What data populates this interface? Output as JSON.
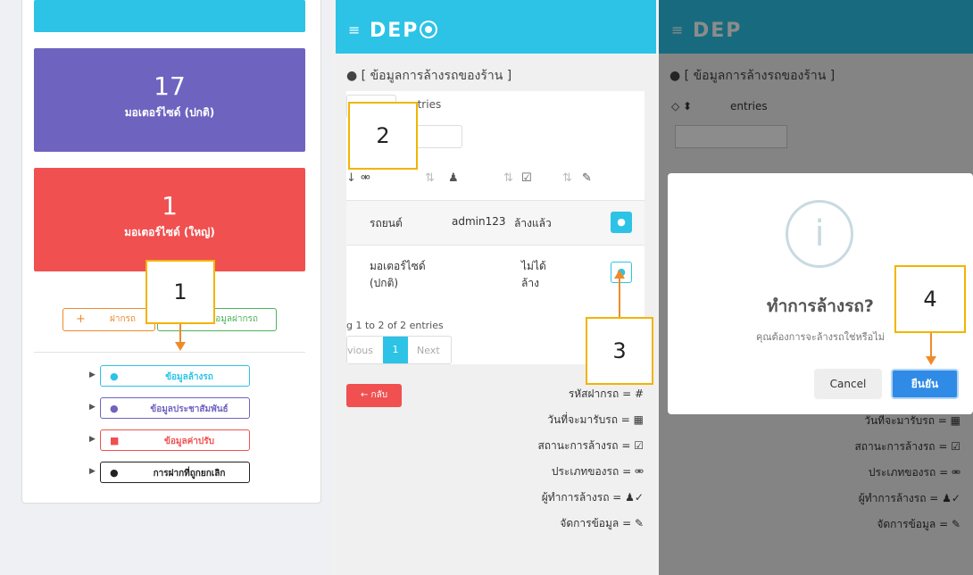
{
  "panel1": {
    "tile_top_color": "#2cc3e6",
    "tile_normal": {
      "count": "17",
      "label": "มอเตอร์ไซด์ (ปกติ)",
      "color": "#6f63c0"
    },
    "tile_big": {
      "count": "1",
      "label": "มอเตอร์ไซด์ (ใหญ่)",
      "color": "#f05050"
    },
    "btn_deposit": {
      "icon": "+",
      "label": "ฝากรถ"
    },
    "btn_deposit_info": {
      "label": "ข้อมูลฝากรถ"
    },
    "menu": [
      {
        "label": "ข้อมูลล้างรถ",
        "icon": "drop-icon",
        "color": "#2cc3e6"
      },
      {
        "label": "ข้อมูลประชาสัมพันธ์",
        "icon": "comment-icon",
        "color": "#6f63c0"
      },
      {
        "label": "ข้อมูลค่าปรับ",
        "icon": "money-icon",
        "color": "#f05050"
      },
      {
        "label": "การฝากที่ถูกยกเลิก",
        "icon": "exclamation-icon",
        "color": "#222222"
      }
    ],
    "callout": "1"
  },
  "panel2": {
    "brand": "DEP",
    "title": "[ ข้อมูลการล้างรถของร้าน ]",
    "entries_label": "ntries",
    "callout": "2",
    "rows": [
      {
        "type": "รถยนต์",
        "user": "admin123",
        "status": "ล้างแล้ว"
      },
      {
        "type": "มอเตอร์ไซด์ (ปกติ)",
        "user": "",
        "status": "ไม่ได้ ล้าง"
      }
    ],
    "info": "g 1 to 2 of 2 entries",
    "pagination": {
      "prev": "vious",
      "page": "1",
      "next": "Next"
    },
    "back": "← กลับ",
    "callout3": "3",
    "legend": [
      "รหัสฝากรถ = #",
      "วันที่จะมารับรถ = ▦",
      "สถานะการล้างรถ = ☑",
      "ประเภทของรถ = ⚮",
      "ผู้ทำการล้างรถ = ♟✓",
      "จัดการข้อมูล = ✎"
    ]
  },
  "panel3": {
    "brand": "DEP",
    "title": "[ ข้อมูลการล้างรถของร้าน ]",
    "entries_label": "entries",
    "modal_title": "ทำการล้างรถ?",
    "modal_text": "คุณต้องการจะล้างรถใช่หรือไม่",
    "cancel": "Cancel",
    "confirm": "ยืนยัน",
    "callout": "4",
    "legend": [
      "วันที่จะมารับรถ = ▦",
      "สถานะการล้างรถ = ☑",
      "ประเภทของรถ = ⚮",
      "ผู้ทำการล้างรถ = ♟✓",
      "จัดการข้อมูล = ✎"
    ]
  }
}
